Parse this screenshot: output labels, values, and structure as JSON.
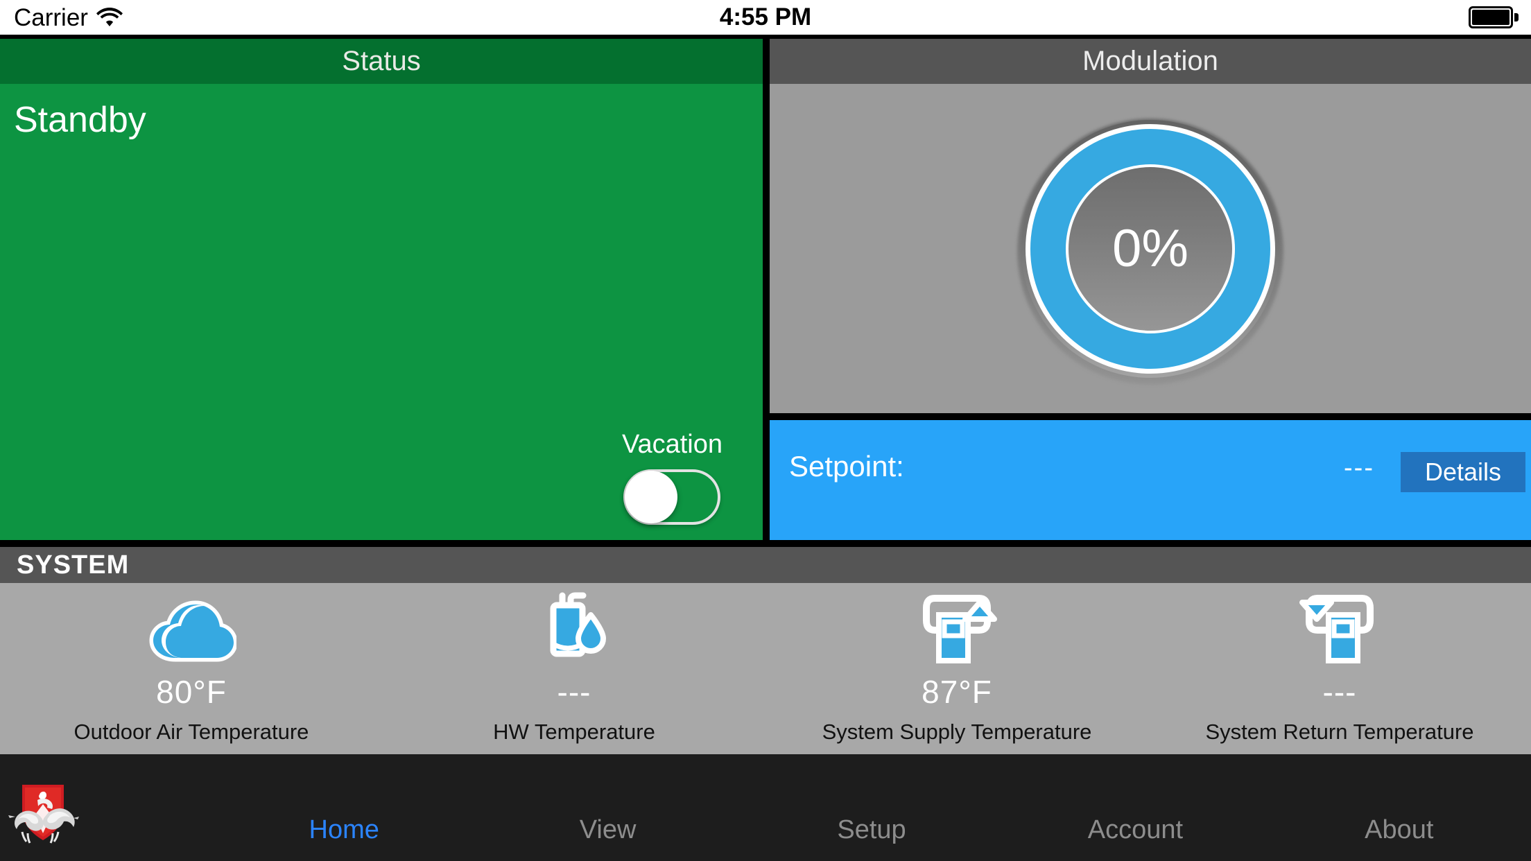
{
  "statusbar": {
    "carrier": "Carrier",
    "wifi_icon": "wifi-icon",
    "time": "4:55 PM",
    "battery_icon": "battery-full-icon"
  },
  "status_panel": {
    "header": "Status",
    "value": "Standby",
    "vacation_label": "Vacation",
    "vacation_on": false,
    "color": "#0d9442",
    "header_color": "#04702f"
  },
  "modulation_panel": {
    "header": "Modulation",
    "percent": "0%",
    "ring_color": "#36a9e1",
    "background": "#9b9b9b"
  },
  "setpoint": {
    "label": "Setpoint:",
    "value": "---",
    "details_label": "Details",
    "background": "#28a4f9",
    "button_color": "#2273be"
  },
  "system": {
    "header": "SYSTEM",
    "tiles": [
      {
        "icon": "cloud-icon",
        "value": "80°F",
        "caption": "Outdoor Air Temperature"
      },
      {
        "icon": "water-heater-droplet-icon",
        "value": "---",
        "caption": "HW Temperature"
      },
      {
        "icon": "boiler-supply-up-arrow-icon",
        "value": "87°F",
        "caption": "System Supply Temperature"
      },
      {
        "icon": "boiler-return-down-arrow-icon",
        "value": "---",
        "caption": "System Return Temperature"
      }
    ]
  },
  "tabbar": {
    "logo_icon": "lochinvar-knight-shield-logo",
    "tabs": [
      {
        "label": "Home",
        "active": true
      },
      {
        "label": "View",
        "active": false
      },
      {
        "label": "Setup",
        "active": false
      },
      {
        "label": "Account",
        "active": false
      },
      {
        "label": "About",
        "active": false
      }
    ],
    "active_color": "#2b84ff",
    "inactive_color": "#8d8d8d"
  }
}
